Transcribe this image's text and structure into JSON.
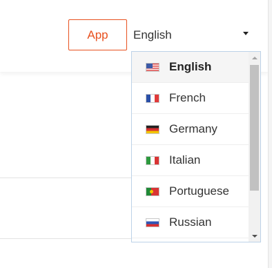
{
  "header": {
    "app_button_label": "App",
    "language_select": {
      "selected_value": "English",
      "caret_icon": "caret-down-icon"
    }
  },
  "language_dropdown": {
    "selected_index": 0,
    "options": [
      {
        "label": "English",
        "flag_icon": "flag-us-icon"
      },
      {
        "label": "French",
        "flag_icon": "flag-fr-icon"
      },
      {
        "label": "Germany",
        "flag_icon": "flag-de-icon"
      },
      {
        "label": "Italian",
        "flag_icon": "flag-it-icon"
      },
      {
        "label": "Portuguese",
        "flag_icon": "flag-pt-icon"
      },
      {
        "label": "Russian",
        "flag_icon": "flag-ru-icon"
      }
    ]
  },
  "colors": {
    "accent": "#e8501e",
    "dropdown_border": "#bcd2e8",
    "selected_bg": "#f5f5f5"
  }
}
